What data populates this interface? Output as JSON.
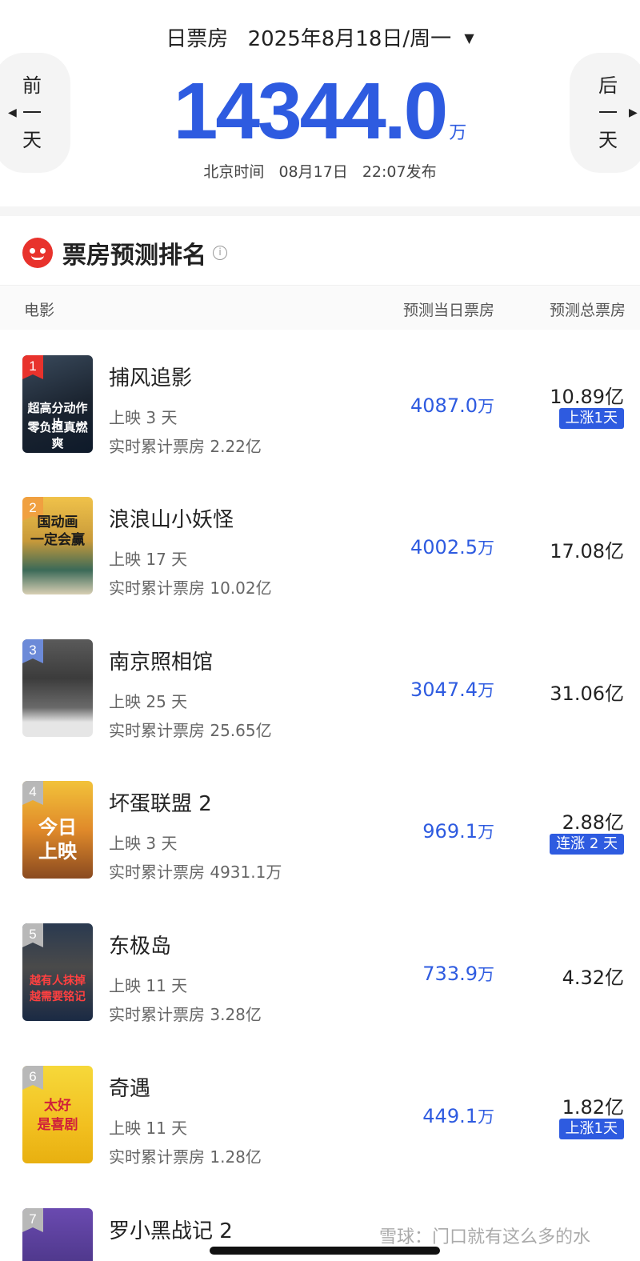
{
  "header": {
    "label": "日票房",
    "date": "2025年8月18日/周一",
    "prev_lines": [
      "前",
      "一",
      "天"
    ],
    "next_lines": [
      "后",
      "一",
      "天"
    ],
    "total": "14344.0",
    "unit": "万",
    "publish_tz": "北京时间",
    "publish_date": "08月17日",
    "publish_time": "22:07发布"
  },
  "section": {
    "title": "票房预测排名",
    "col_movie": "电影",
    "col_daily": "预测当日票房",
    "col_total": "预测总票房"
  },
  "colors": {
    "accent": "#2e5be0",
    "brand_red": "#e8322c"
  },
  "movies": [
    {
      "rank": "1",
      "name": "捕风追影",
      "days": "上映 3 天",
      "cumulative": "实时累计票房 2.22亿",
      "daily": "4087.0",
      "daily_unit": "万",
      "total": "10.89亿",
      "badge": "上涨1天",
      "poster_lines": [
        "超高分动作片",
        "零负担真燃爽"
      ]
    },
    {
      "rank": "2",
      "name": "浪浪山小妖怪",
      "days": "上映 17 天",
      "cumulative": "实时累计票房 10.02亿",
      "daily": "4002.5",
      "daily_unit": "万",
      "total": "17.08亿",
      "badge": "",
      "poster_lines": [
        "国动画",
        "一定会赢"
      ]
    },
    {
      "rank": "3",
      "name": "南京照相馆",
      "days": "上映 25 天",
      "cumulative": "实时累计票房 25.65亿",
      "daily": "3047.4",
      "daily_unit": "万",
      "total": "31.06亿",
      "badge": "",
      "poster_lines": []
    },
    {
      "rank": "4",
      "name": "坏蛋联盟 2",
      "days": "上映 3 天",
      "cumulative": "实时累计票房 4931.1万",
      "daily": "969.1",
      "daily_unit": "万",
      "total": "2.88亿",
      "badge": "连涨 2 天",
      "poster_lines": [
        "今日",
        "上映"
      ]
    },
    {
      "rank": "5",
      "name": "东极岛",
      "days": "上映 11 天",
      "cumulative": "实时累计票房 3.28亿",
      "daily": "733.9",
      "daily_unit": "万",
      "total": "4.32亿",
      "badge": "",
      "poster_lines": [
        "越有人抹掉",
        "越需要铭记"
      ]
    },
    {
      "rank": "6",
      "name": "奇遇",
      "days": "上映 11 天",
      "cumulative": "实时累计票房 1.28亿",
      "daily": "449.1",
      "daily_unit": "万",
      "total": "1.82亿",
      "badge": "上涨1天",
      "poster_lines": [
        "太好",
        "是喜剧"
      ]
    },
    {
      "rank": "7",
      "name": "罗小黑战记 2",
      "days": "",
      "cumulative": "",
      "daily": "",
      "daily_unit": "",
      "total": "",
      "badge": "",
      "poster_lines": []
    }
  ],
  "watermark": "雪球：门口就有这么多的水"
}
